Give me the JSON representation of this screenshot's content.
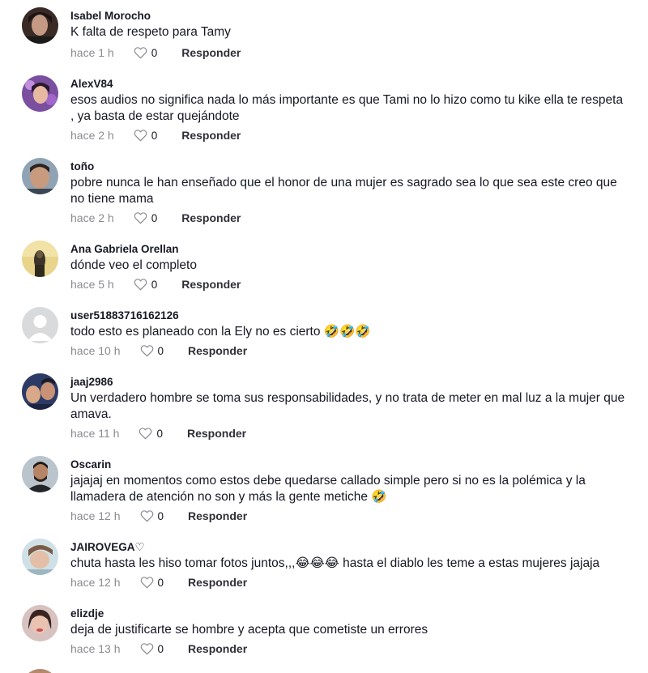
{
  "comments": [
    {
      "username": "Isabel Morocho",
      "text": "K falta de respeto para Tamy",
      "time": "hace 1 h",
      "likes": "0",
      "reply": "Responder",
      "avatar_icon": "user-photo"
    },
    {
      "username": "AlexV84",
      "text": "esos audios no significa nada lo más importante es que Tami no lo hizo como tu kike ella te respeta , ya basta de estar quejándote",
      "time": "hace 2 h",
      "likes": "0",
      "reply": "Responder",
      "avatar_icon": "user-photo"
    },
    {
      "username": "toño",
      "text": "pobre nunca le han enseñado que el honor de una mujer es sagrado sea lo que sea este creo que no tiene mama",
      "time": "hace 2 h",
      "likes": "0",
      "reply": "Responder",
      "avatar_icon": "user-photo"
    },
    {
      "username": "Ana Gabriela Orellan",
      "text": "dónde veo el completo",
      "time": "hace 5 h",
      "likes": "0",
      "reply": "Responder",
      "avatar_icon": "user-photo"
    },
    {
      "username": "user51883716162126",
      "text": "todo esto es planeado con la Ely no es cierto",
      "emoji": "🤣🤣🤣",
      "time": "hace 10 h",
      "likes": "0",
      "reply": "Responder",
      "avatar_icon": "default-avatar-icon"
    },
    {
      "username": "jaaj2986",
      "text": "Un verdadero hombre se toma sus responsabilidades, y no trata de meter en mal luz a la mujer que amava.",
      "time": "hace 11 h",
      "likes": "0",
      "reply": "Responder",
      "avatar_icon": "user-photo"
    },
    {
      "username": "Oscarin",
      "text": "jajajaj en momentos como estos debe quedarse callado simple pero si no es la polémica y la llamadera de atención no son y más la gente metiche",
      "emoji": "🤣",
      "time": "hace 12 h",
      "likes": "0",
      "reply": "Responder",
      "avatar_icon": "user-photo"
    },
    {
      "username": "JAIROVEGA♡",
      "text_before": "chuta hasta les hiso tomar fotos juntos,,,",
      "emoji": "😂😂😂",
      "text_after": " hasta el diablo les teme a estas mujeres jajaja",
      "time": "hace 12 h",
      "likes": "0",
      "reply": "Responder",
      "avatar_icon": "user-photo"
    },
    {
      "username": "elizdje",
      "text": "deja de justificarte se hombre y acepta que cometiste un errores",
      "time": "hace 13 h",
      "likes": "0",
      "reply": "Responder",
      "avatar_icon": "user-photo"
    }
  ],
  "colors": {
    "text": "#161823",
    "meta": "#8a8b91",
    "default_avatar_bg": "#d9dadc"
  },
  "icons": {
    "like": "heart-outline-icon"
  }
}
